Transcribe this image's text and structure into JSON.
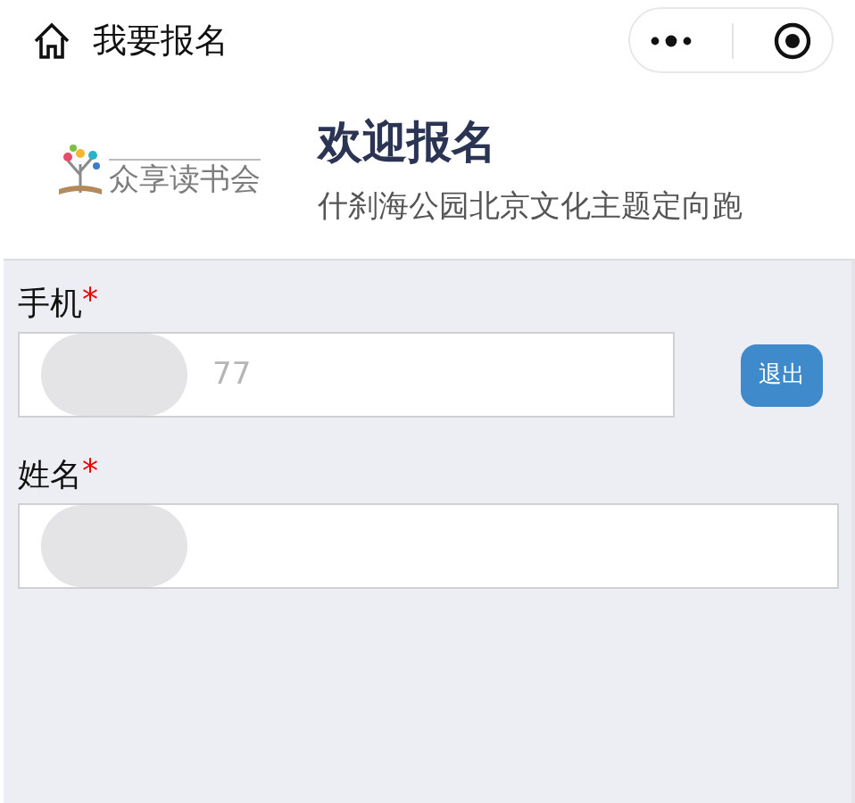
{
  "nav_bar": {
    "title": "我要报名"
  },
  "header": {
    "logo_text": "众享读书会",
    "title": "欢迎报名",
    "subtitle": "什刹海公园北京文化主题定向跑"
  },
  "form": {
    "fields": [
      {
        "label": "手机",
        "required_mark": "*",
        "value": "77",
        "masked": true,
        "kind": "with_button",
        "button": "退出"
      },
      {
        "label": "姓名",
        "required_mark": "*",
        "masked": true,
        "kind": "plain"
      }
    ]
  }
}
